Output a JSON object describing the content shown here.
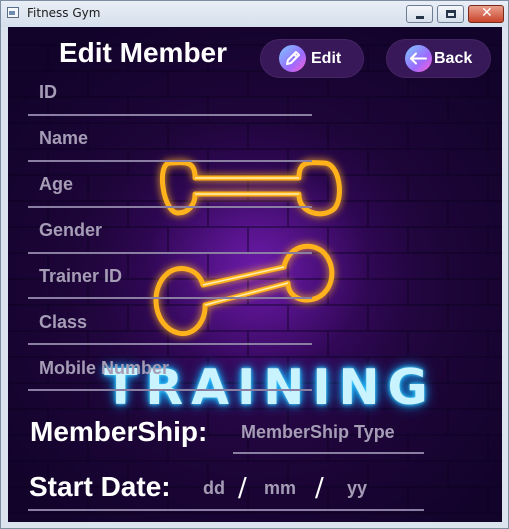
{
  "window": {
    "title": "Fitness Gym"
  },
  "header": {
    "title": "Edit Member"
  },
  "buttons": {
    "edit_label": "Edit",
    "back_label": "Back"
  },
  "fields": [
    {
      "label": "ID"
    },
    {
      "label": "Name"
    },
    {
      "label": "Age"
    },
    {
      "label": "Gender"
    },
    {
      "label": "Trainer ID"
    },
    {
      "label": "Class"
    },
    {
      "label": "Mobile Number"
    }
  ],
  "background": {
    "sign_text": "TRAINING"
  },
  "membership": {
    "label": "MemberShip:",
    "placeholder": "MemberShip Type"
  },
  "start_date": {
    "label": "Start Date:",
    "day": "dd",
    "month": "mm",
    "year": "yy",
    "separator": "/"
  },
  "colors": {
    "neon_orange": "#ffb21a",
    "neon_blue": "#37cfff",
    "bg_purple": "#2a0848"
  }
}
